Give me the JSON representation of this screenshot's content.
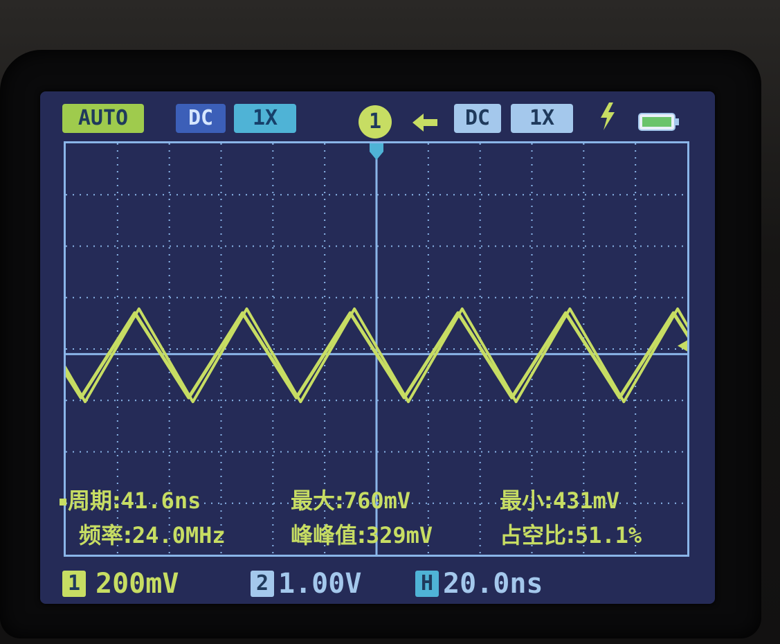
{
  "status_bar": {
    "trigger_mode": "AUTO",
    "ch1_coupling": "DC",
    "ch1_probe": "1X",
    "trigger_channel": "1",
    "trigger_edge_icon": "arrow-left-icon",
    "ch2_coupling": "DC",
    "ch2_probe": "1X",
    "trigger_icon": "bolt-icon",
    "battery_icon": "battery-icon"
  },
  "measurements": {
    "period_label": "周期:",
    "period_value": "41.6ns",
    "frequency_label": "频率:",
    "frequency_value": "24.0MHz",
    "max_label": "最大:",
    "max_value": "760mV",
    "pkpk_label": "峰峰值:",
    "pkpk_value": "329mV",
    "min_label": "最小:",
    "min_value": "431mV",
    "duty_label": "占空比:",
    "duty_value": "51.1%"
  },
  "bottom_bar": {
    "ch1_badge": "1",
    "ch1_scale": "200mV",
    "ch2_badge": "2",
    "ch2_scale": "1.00V",
    "time_badge": "H",
    "time_scale": "20.0ns"
  },
  "waveform": {
    "period_divisions": 2.08,
    "max_mv": 760,
    "min_mv": 431,
    "volts_per_div_mv": 200,
    "grid_divisions": [
      12,
      8
    ]
  },
  "colors": {
    "screen_bg": "#252b57",
    "trace": "#c7dd63",
    "grid": "#8ab5e8",
    "auto_chip": "#9fcb4d",
    "ch2_chip": "#a4c8ec",
    "time_badge": "#4fb3d6"
  }
}
